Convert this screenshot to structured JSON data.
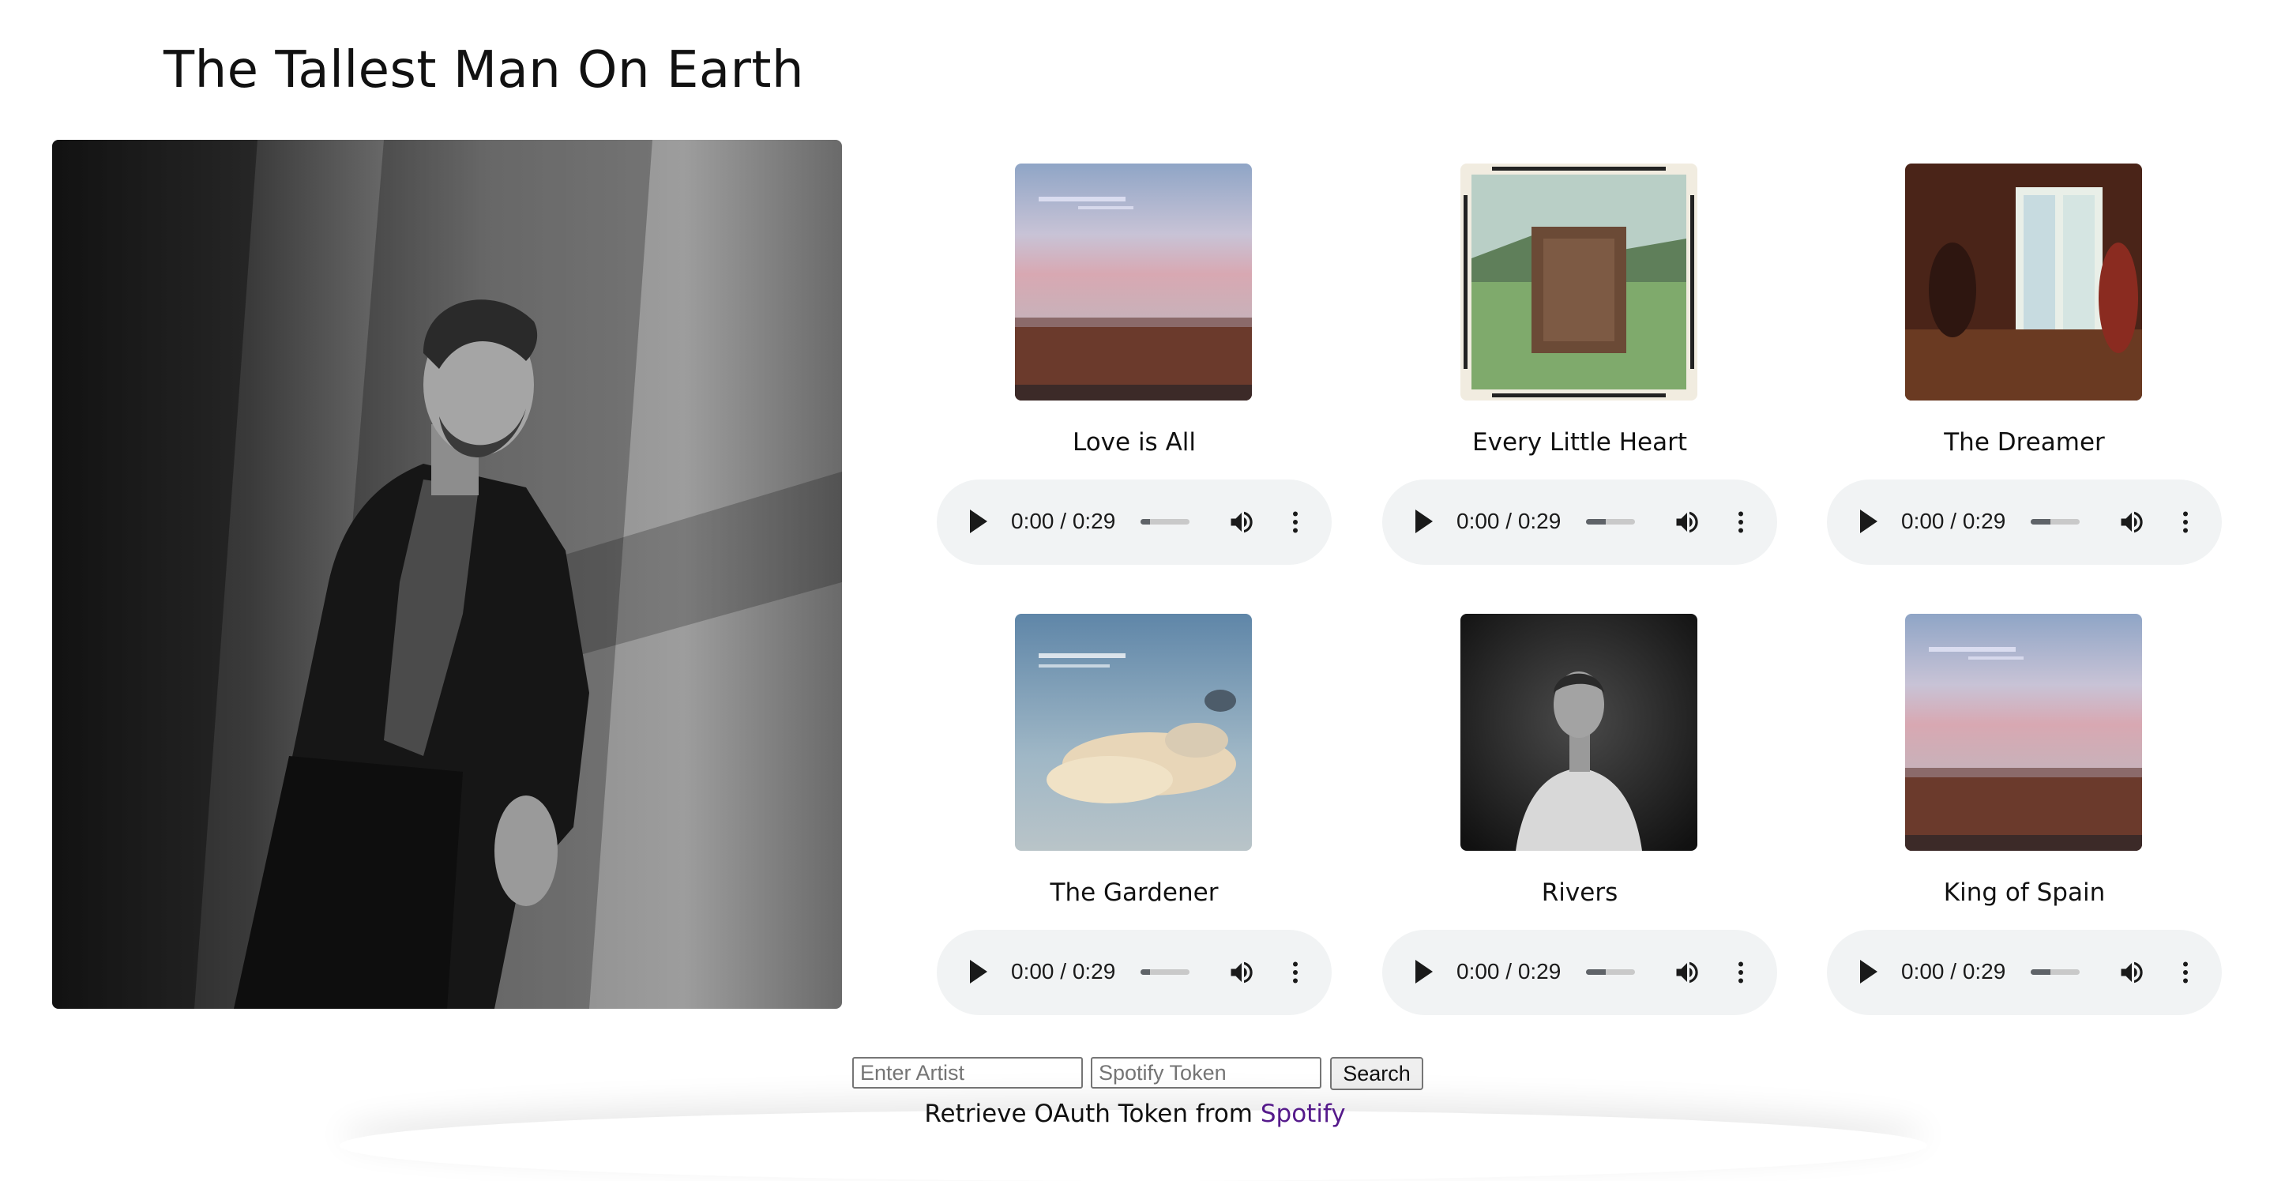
{
  "artist": {
    "name": "The Tallest Man On Earth"
  },
  "tracks": [
    {
      "title": "Love is All",
      "time": "0:00 / 0:29",
      "progress": 0.2,
      "cover": "sky-field"
    },
    {
      "title": "Every Little Heart",
      "time": "0:00 / 0:29",
      "progress": 0.4,
      "cover": "henry-st"
    },
    {
      "title": "The Dreamer",
      "time": "0:00 / 0:29",
      "progress": 0.4,
      "cover": "window-room"
    },
    {
      "title": "The Gardener",
      "time": "0:00 / 0:29",
      "progress": 0.2,
      "cover": "clouds"
    },
    {
      "title": "Rivers",
      "time": "0:00 / 0:29",
      "progress": 0.4,
      "cover": "portrait"
    },
    {
      "title": "King of Spain",
      "time": "0:00 / 0:29",
      "progress": 0.4,
      "cover": "sky-field"
    }
  ],
  "search": {
    "artist_placeholder": "Enter Artist",
    "token_placeholder": "Spotify Token",
    "button_label": "Search"
  },
  "oauth": {
    "prefix": "Retrieve OAuth Token from ",
    "link_text": "Spotify"
  },
  "icons": {
    "play": "play-icon",
    "volume": "volume-icon",
    "menu": "more-vert-icon"
  }
}
